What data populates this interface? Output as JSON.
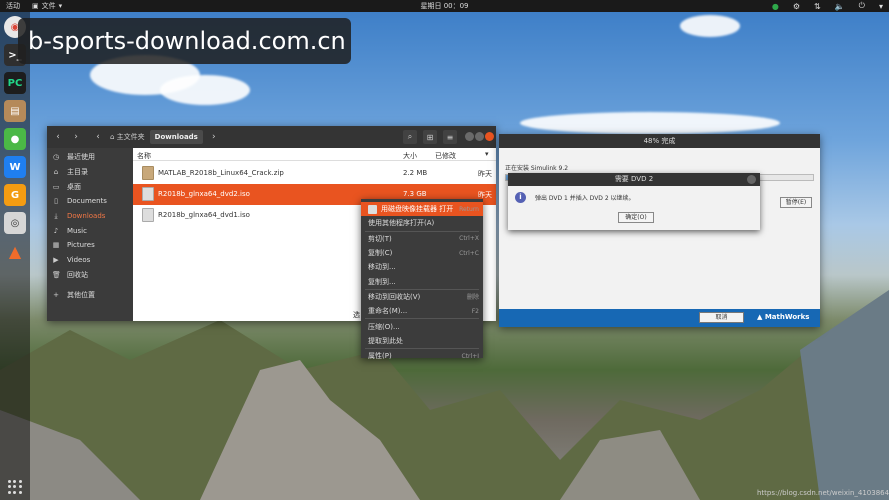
{
  "topbar": {
    "activities": "活动",
    "app_menu": "文件",
    "clock": "星期日 00：09"
  },
  "watermark": "b-sports-download.com.cn",
  "file_manager": {
    "breadcrumb_home": "主文件夹",
    "breadcrumb_current": "Downloads",
    "sidebar": [
      {
        "label": "最近使用",
        "icon": "clock-icon"
      },
      {
        "label": "主目录",
        "icon": "home-icon"
      },
      {
        "label": "桌面",
        "icon": "desktop-icon"
      },
      {
        "label": "Documents",
        "icon": "document-icon"
      },
      {
        "label": "Downloads",
        "icon": "download-icon",
        "selected": true
      },
      {
        "label": "Music",
        "icon": "music-icon"
      },
      {
        "label": "Pictures",
        "icon": "picture-icon"
      },
      {
        "label": "Videos",
        "icon": "video-icon"
      },
      {
        "label": "回收站",
        "icon": "trash-icon"
      },
      {
        "label": "其他位置",
        "icon": "plus-icon"
      }
    ],
    "columns": {
      "name": "名称",
      "size": "大小",
      "modified": "已修改"
    },
    "files": [
      {
        "name": "MATLAB_R2018b_Linux64_Crack.zip",
        "size": "2.2 MB",
        "modified": "昨天",
        "type": "zip"
      },
      {
        "name": "R2018b_glnxa64_dvd2.iso",
        "size": "7.3 GB",
        "modified": "昨天",
        "type": "iso",
        "selected": true
      },
      {
        "name": "R2018b_glnxa64_dvd1.iso",
        "size": "",
        "modified": "",
        "type": "iso"
      }
    ],
    "bottom_text": "选"
  },
  "installer": {
    "title": "48% 完成",
    "status": "正在安装 Simulink 9.2",
    "progress": 0.48,
    "pause_label": "暂停(E)",
    "cancel_label": "取消",
    "brand": "MathWorks"
  },
  "dialog": {
    "title": "需要 DVD 2",
    "message": "弹出 DVD 1 并插入 DVD 2 以继续。",
    "ok_label": "确定(O)"
  },
  "context_menu": [
    {
      "label": "用磁盘映像挂载器 打开",
      "shortcut": "Return",
      "highlighted": true
    },
    {
      "label": "使用其他程序打开(A)",
      "shortcut": ""
    },
    {
      "label": "剪切(T)",
      "shortcut": "Ctrl+X"
    },
    {
      "label": "复制(C)",
      "shortcut": "Ctrl+C"
    },
    {
      "label": "移动到...",
      "shortcut": ""
    },
    {
      "label": "复制到...",
      "shortcut": ""
    },
    {
      "label": "移动到回收站(V)",
      "shortcut": "删除"
    },
    {
      "label": "重命名(M)...",
      "shortcut": "F2"
    },
    {
      "label": "压缩(O)...",
      "shortcut": ""
    },
    {
      "label": "提取到此处",
      "shortcut": ""
    },
    {
      "label": "属性(P)",
      "shortcut": "Ctrl+I"
    }
  ],
  "credit": "https://blog.csdn.net/weixin_41038644"
}
